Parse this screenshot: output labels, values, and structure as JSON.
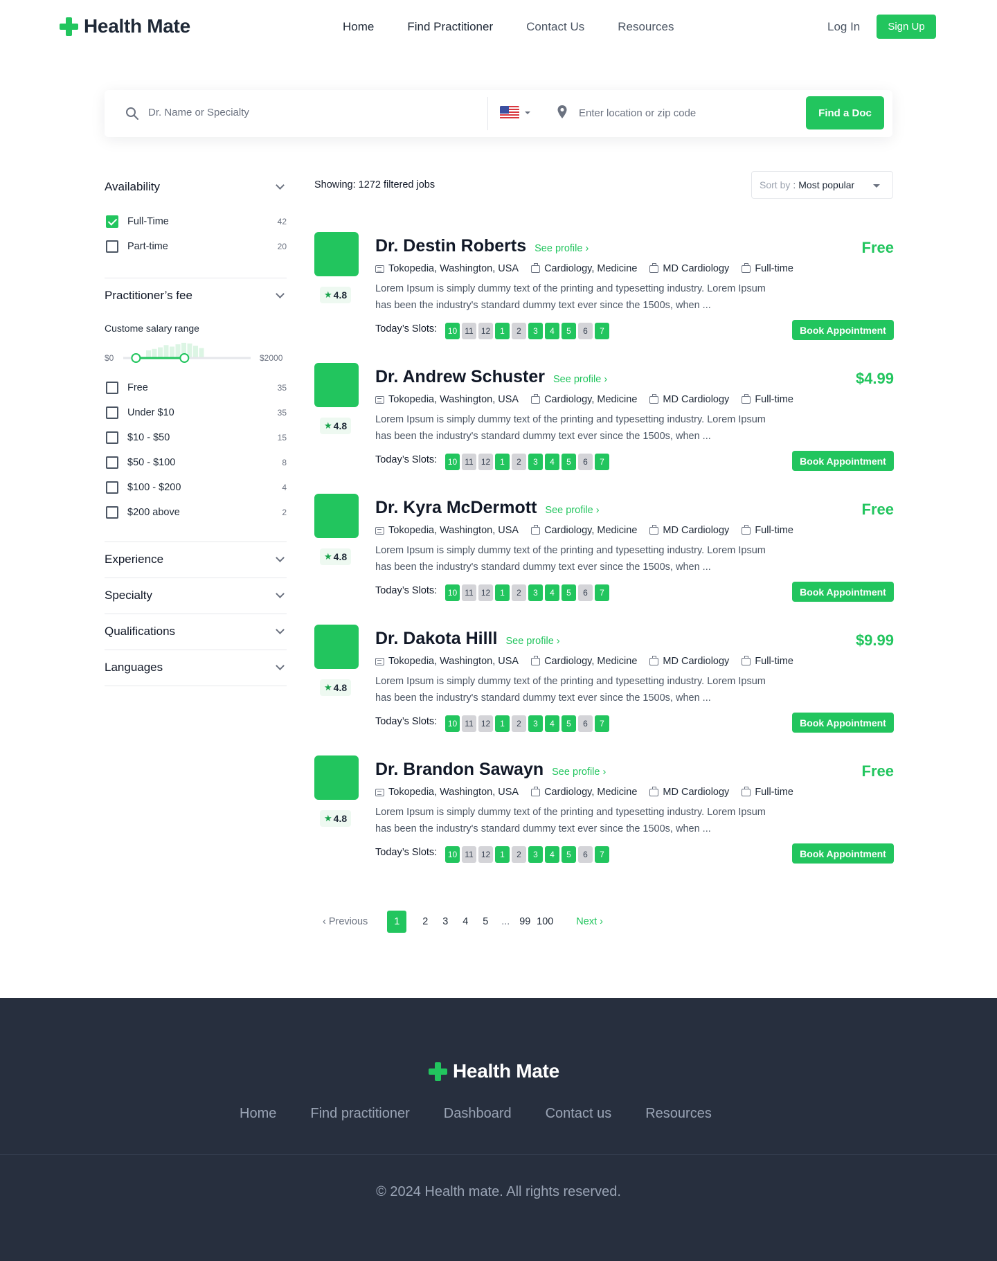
{
  "brand": {
    "name": "Health Mate",
    "accent": "#22c55e",
    "dark": "#272f3e"
  },
  "header": {
    "nav": [
      "Home",
      "Find Practitioner",
      "Contact Us",
      "Resources"
    ],
    "login": "Log In",
    "signup": "Sign Up"
  },
  "search": {
    "name_placeholder": "Dr. Name or Specialty",
    "country_flag": "us-flag-icon",
    "location_placeholder": "Enter location or zip code",
    "button": "Find a Doc"
  },
  "sidebar": {
    "availability": {
      "title": "Availability",
      "options": [
        {
          "label": "Full-Time",
          "count": "42",
          "checked": true
        },
        {
          "label": "Part-time",
          "count": "20",
          "checked": false
        }
      ]
    },
    "fee": {
      "title": "Practitioner’s fee",
      "range_label": "Custome salary range",
      "min": "$0",
      "max": "$2000",
      "selected_range_fraction": [
        0.1,
        0.48
      ],
      "histogram": [
        0.5,
        0.6,
        0.7,
        0.85,
        0.75,
        0.9,
        1.0,
        0.95,
        0.8,
        0.65
      ],
      "options": [
        {
          "label": "Free",
          "count": "35"
        },
        {
          "label": "Under $10",
          "count": "35"
        },
        {
          "label": "$10 - $50",
          "count": "15"
        },
        {
          "label": "$50 - $100",
          "count": "8"
        },
        {
          "label": "$100 - $200",
          "count": "4"
        },
        {
          "label": "$200 above",
          "count": "2"
        }
      ]
    },
    "collapsed": [
      "Experience",
      "Specialty",
      "Qualifications",
      "Languages"
    ]
  },
  "results": {
    "showing": "Showing: 1272 filtered jobs",
    "sort_label": "Sort by",
    "sort_sep": ":",
    "sort_value": "Most popular",
    "see_profile": "See profile ›",
    "slots_label": "Today’s Slots:",
    "book_label": "Book Appointment",
    "slots": [
      {
        "t": "10",
        "available": true
      },
      {
        "t": "11",
        "available": false
      },
      {
        "t": "12",
        "available": false
      },
      {
        "t": "1",
        "available": true
      },
      {
        "t": "2",
        "available": false
      },
      {
        "t": "3",
        "available": true
      },
      {
        "t": "4",
        "available": true
      },
      {
        "t": "5",
        "available": true
      },
      {
        "t": "6",
        "available": false
      },
      {
        "t": "7",
        "available": true
      }
    ],
    "doctors": [
      {
        "name": "Dr. Destin Roberts",
        "price": "Free",
        "rating": "4.8",
        "location": "Tokopedia, Washington, USA",
        "specialty": "Cardiology, Medicine",
        "degree": "MD Cardiology",
        "type": "Full-time",
        "desc": "Lorem Ipsum is simply dummy text of the printing and typesetting industry. Lorem Ipsum has been the industry's standard dummy text ever since the 1500s, when ..."
      },
      {
        "name": "Dr. Andrew Schuster",
        "price": "$4.99",
        "rating": "4.8",
        "location": "Tokopedia, Washington, USA",
        "specialty": "Cardiology, Medicine",
        "degree": "MD Cardiology",
        "type": "Full-time",
        "desc": "Lorem Ipsum is simply dummy text of the printing and typesetting industry. Lorem Ipsum has been the industry's standard dummy text ever since the 1500s, when ..."
      },
      {
        "name": "Dr. Kyra McDermott",
        "price": "Free",
        "rating": "4.8",
        "location": "Tokopedia, Washington, USA",
        "specialty": "Cardiology, Medicine",
        "degree": "MD Cardiology",
        "type": "Full-time",
        "desc": "Lorem Ipsum is simply dummy text of the printing and typesetting industry. Lorem Ipsum has been the industry's standard dummy text ever since the 1500s, when ..."
      },
      {
        "name": "Dr. Dakota Hilll",
        "price": "$9.99",
        "rating": "4.8",
        "location": "Tokopedia, Washington, USA",
        "specialty": "Cardiology, Medicine",
        "degree": "MD Cardiology",
        "type": "Full-time",
        "desc": "Lorem Ipsum is simply dummy text of the printing and typesetting industry. Lorem Ipsum has been the industry's standard dummy text ever since the 1500s, when ..."
      },
      {
        "name": "Dr. Brandon Sawayn",
        "price": "Free",
        "rating": "4.8",
        "location": "Tokopedia, Washington, USA",
        "specialty": "Cardiology, Medicine",
        "degree": "MD Cardiology",
        "type": "Full-time",
        "desc": "Lorem Ipsum is simply dummy text of the printing and typesetting industry. Lorem Ipsum has been the industry's standard dummy text ever since the 1500s, when ..."
      }
    ]
  },
  "pagination": {
    "prev": "‹  Previous",
    "pages": [
      "1",
      "2",
      "3",
      "4",
      "5"
    ],
    "dots": "...",
    "last_pages": [
      "99",
      "100"
    ],
    "next": "Next  ›",
    "current": "1"
  },
  "footer": {
    "brand": "Health Mate",
    "nav": [
      "Home",
      "Find practitioner",
      "Dashboard",
      "Contact us",
      "Resources"
    ],
    "copyright": "© 2024 Health mate. All rights reserved."
  }
}
